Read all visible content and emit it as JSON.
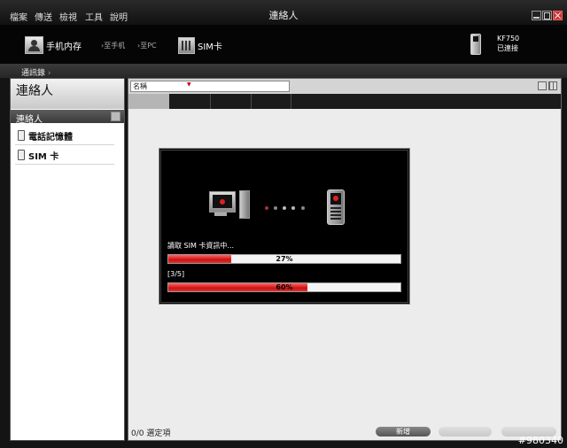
{
  "menu": [
    "檔案",
    "傳送",
    "檢視",
    "工具",
    "說明"
  ],
  "window": {
    "title": "連絡人"
  },
  "toolbar": {
    "phone_memory": "手机内存",
    "to_phone": "至手机",
    "to_pc": "至PC",
    "sim_card": "SIM卡",
    "device_model": "KF750",
    "device_status": "已連接"
  },
  "breadcrumb": "通訊錄",
  "sidebar": {
    "title": "連絡人",
    "section": "連絡人",
    "items": [
      "電話記憶體",
      "SIM 卡"
    ]
  },
  "main": {
    "sort_select": "名稱",
    "status": "0/0 選定項",
    "new_button": "新增",
    "edit_button": "",
    "delete_button": ""
  },
  "dialog": {
    "message": "讀取 SIM 卡資訊中...",
    "progress1": {
      "label": "27%",
      "value": 0.27
    },
    "step": "[3/5]",
    "progress2": {
      "label": "60%",
      "value": 0.6
    }
  },
  "watermark": "#980340",
  "colors": {
    "accent": "#cc1111",
    "background": "#141414"
  }
}
